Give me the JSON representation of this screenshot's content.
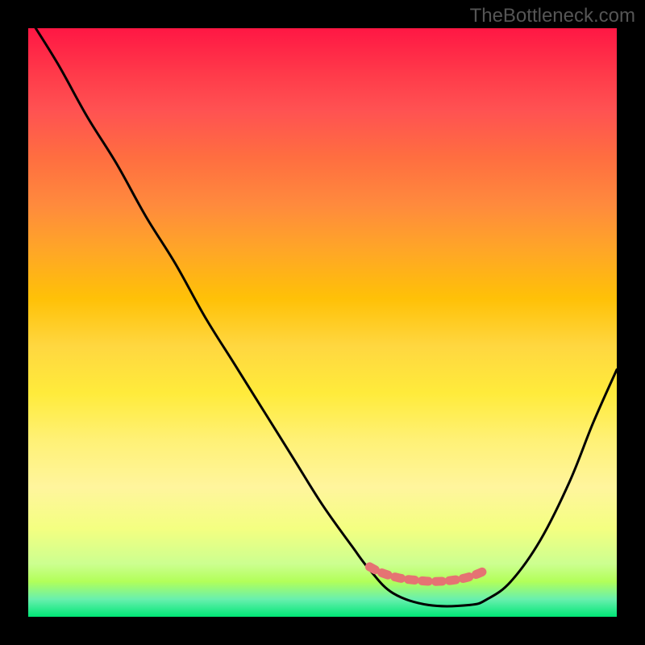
{
  "watermark": "TheBottleneck.com",
  "chart_data": {
    "type": "line",
    "title": "",
    "xlabel": "",
    "ylabel": "",
    "xlim": [
      0,
      100
    ],
    "ylim": [
      0,
      100
    ],
    "series": [
      {
        "name": "bottleneck-curve",
        "x": [
          0,
          5,
          10,
          15,
          20,
          25,
          30,
          35,
          40,
          45,
          50,
          55,
          58,
          62,
          68,
          75,
          78,
          82,
          87,
          92,
          96,
          100
        ],
        "values": [
          102,
          94,
          85,
          77,
          68,
          60,
          51,
          43,
          35,
          27,
          19,
          12,
          8,
          4,
          2,
          2,
          3,
          6,
          13,
          23,
          33,
          42
        ]
      },
      {
        "name": "optimal-band",
        "x": [
          58,
          60,
          63,
          66,
          69,
          72,
          75,
          78
        ],
        "values": [
          8.5,
          7.5,
          6.6,
          6.2,
          6.0,
          6.2,
          6.8,
          8.0
        ]
      }
    ],
    "colors": {
      "curve": "#000000",
      "band": "#e57373",
      "bg_top": "#ff1744",
      "bg_bottom": "#00e676"
    }
  }
}
